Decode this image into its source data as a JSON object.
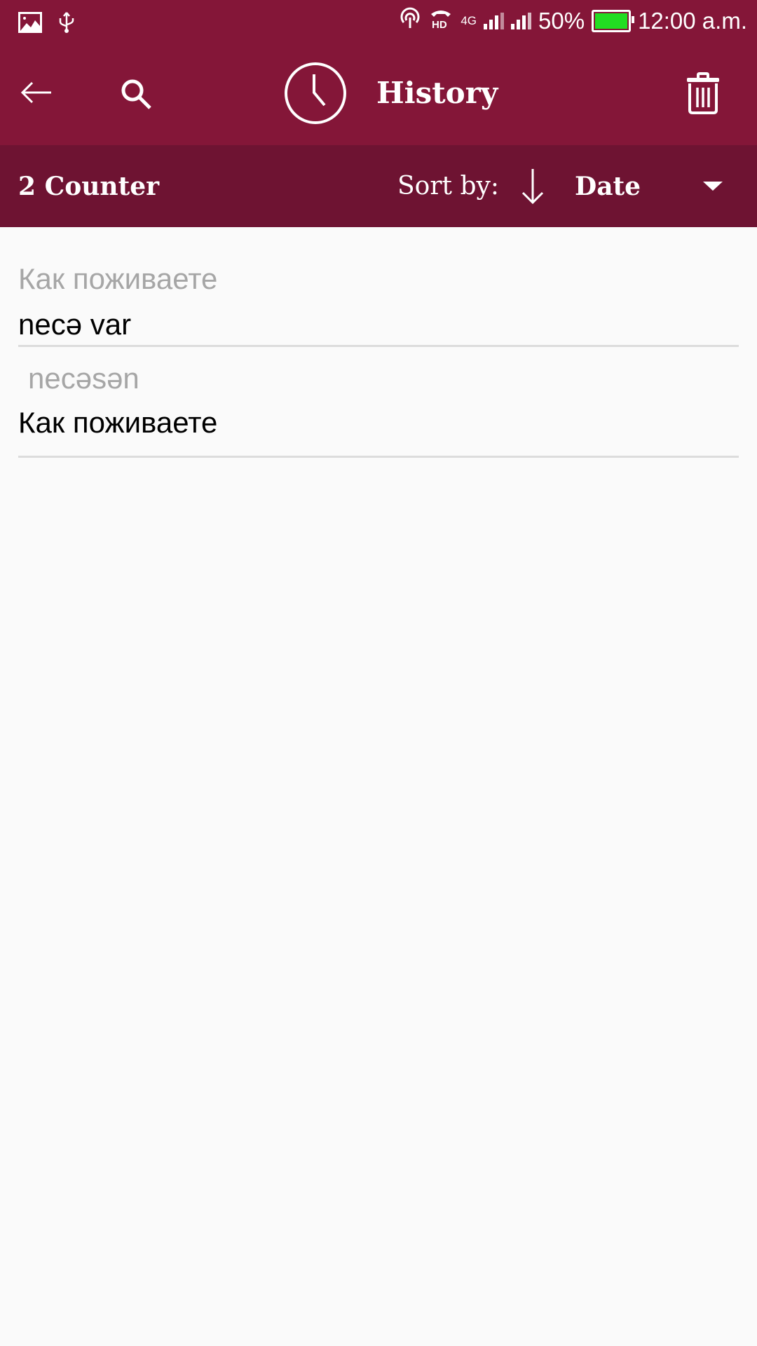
{
  "status_bar": {
    "left_icons": [
      "image-icon",
      "usb-icon"
    ],
    "right_icons": [
      "hotspot-icon",
      "hd-call-icon",
      "signal-sim1-icon",
      "signal-sim2-icon",
      "battery-icon"
    ],
    "network": "4G",
    "battery_percent": "50%",
    "battery_level": 0.5,
    "time": "12:00 a.m."
  },
  "app_bar": {
    "back_icon": "arrow-left-icon",
    "search_icon": "search-icon",
    "title_icon": "clock-icon",
    "title": "History",
    "delete_icon": "trash-icon"
  },
  "sub_bar": {
    "counter": "2 Counter",
    "sort_label": "Sort by:",
    "sort_direction_icon": "arrow-down-icon",
    "sort_value": "Date",
    "dropdown_icon": "triangle-down-icon"
  },
  "history": [
    {
      "source": "Как поживаете",
      "translation": "necə var"
    },
    {
      "source": "necəsən",
      "translation": "Как поживаете"
    }
  ],
  "colors": {
    "primary": "#841638",
    "primary_dark": "#6E1332",
    "background": "#FAFAFA",
    "source_text": "#A6A6A6",
    "divider": "#DCDCDC",
    "battery": "#22DD22"
  }
}
